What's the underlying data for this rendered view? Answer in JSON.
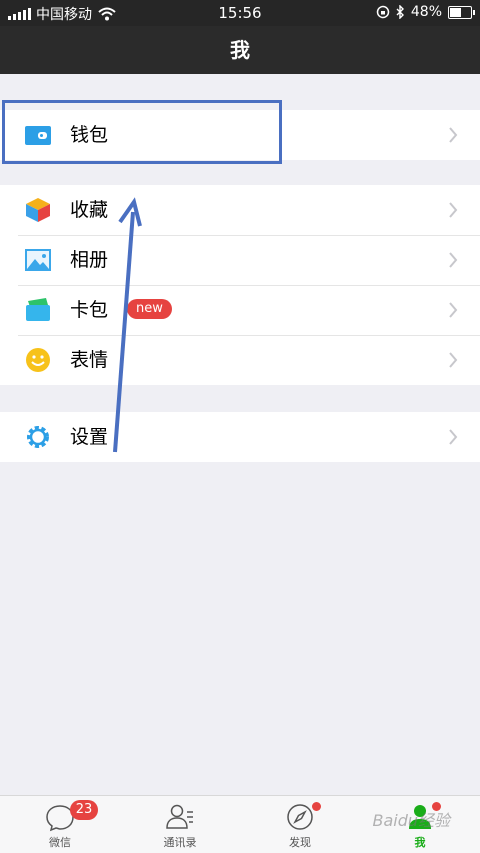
{
  "status_bar": {
    "carrier": "中国移动",
    "time": "15:56",
    "battery": "48%",
    "battery_level": 0.48
  },
  "nav": {
    "title": "我"
  },
  "groups": [
    {
      "items": [
        {
          "label": "钱包",
          "icon": "wallet-icon"
        }
      ]
    },
    {
      "items": [
        {
          "label": "收藏",
          "icon": "favorites-cube-icon"
        },
        {
          "label": "相册",
          "icon": "album-picture-icon"
        },
        {
          "label": "卡包",
          "icon": "card-pack-icon",
          "badge": "new"
        },
        {
          "label": "表情",
          "icon": "sticker-smile-icon"
        }
      ]
    },
    {
      "items": [
        {
          "label": "设置",
          "icon": "settings-gear-icon"
        }
      ]
    }
  ],
  "tabs": [
    {
      "label": "微信",
      "icon": "chat-bubble-icon",
      "badge": "23"
    },
    {
      "label": "通讯录",
      "icon": "contacts-icon"
    },
    {
      "label": "发现",
      "icon": "discover-compass-icon",
      "dot": true
    },
    {
      "label": "我",
      "icon": "me-person-icon",
      "dot": true,
      "active": true
    }
  ],
  "colors": {
    "accent_green": "#1aad19",
    "badge_red": "#e64340",
    "nav_bg": "#2b2b2b",
    "annotation_blue": "#4a6fc1"
  },
  "watermark": "Baidu经验"
}
